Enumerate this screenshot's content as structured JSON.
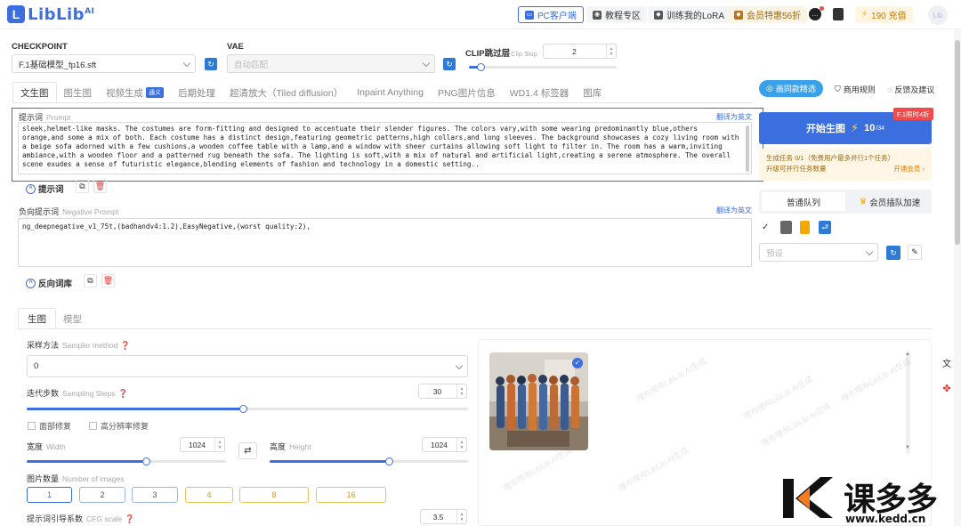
{
  "header": {
    "logo_text": "LibLib",
    "logo_sup": "AI",
    "pc_client": "PC客户端",
    "tutorial": "教程专区",
    "train_lora": "训练我的LoRA",
    "member": "会员特惠56折",
    "credits": "190 充值",
    "avatar": "Lib"
  },
  "checkpoint": {
    "label": "CHECKPOINT",
    "value": "F.1基础模型_fp16.sft"
  },
  "vae": {
    "label": "VAE",
    "value": "自动匹配"
  },
  "clip": {
    "label": "CLIP跳过层",
    "sublabel": "Clip Skip",
    "value": "2",
    "level": 0.08
  },
  "tabs": [
    {
      "label": "文生图"
    },
    {
      "label": "图生图"
    },
    {
      "label": "视频生成",
      "badge": "通义"
    },
    {
      "label": "后期处理"
    },
    {
      "label": "超清放大（Tiled diffusion）"
    },
    {
      "label": "Inpaint Anything"
    },
    {
      "label": "PNG图片信息"
    },
    {
      "label": "WD1.4 标签器"
    },
    {
      "label": "图库"
    }
  ],
  "right_links": {
    "pick": "画同款精选",
    "rules": "商用规则",
    "feedback": "反馈及建议"
  },
  "prompt": {
    "label": "提示词",
    "sublabel": "Prompt",
    "translate": "翻译为英文",
    "text": "sleek,helmet-like masks. The costumes are form-fitting and designed to accentuate their slender figures. The colors vary,with some wearing predominantly blue,others orange,and some a mix of both. Each costume has a distinct design,featuring geometric patterns,high collars,and long sleeves. The background showcases a cozy living room with a beige sofa adorned with a few cushions,a wooden coffee table with a lamp,and a window with sheer curtains allowing soft light to filter in. The room has a warm,inviting ambiance,with a wooden floor and a patterned rug beneath the sofa. The lighting is soft,with a mix of natural and artificial light,creating a serene atmosphere. The overall scene exudes a sense of futuristic elegance,blending elements of fashion and technology in a domestic setting..",
    "chip": "提示词"
  },
  "negative": {
    "label": "负向提示词",
    "sublabel": "Negative Prompt",
    "translate": "翻译为英文",
    "text": "ng_deepnegative_v1_75t,(badhandv4:1.2),EasyNegative,(worst quality:2),",
    "chip": "反向词库"
  },
  "generate": {
    "label": "开始生图",
    "cost": "10",
    "cost_suffix": "/34",
    "promo": "F.1限时4折"
  },
  "task": {
    "line1": "生成任务 0/1（免费用户最多并行1个任务）",
    "line2": "升级可并行任务数量",
    "upgrade": "开通会员 ›"
  },
  "queue": {
    "normal": "普通队列",
    "vip": "会员插队加速"
  },
  "preset": {
    "placeholder": "预设"
  },
  "subtabs": [
    {
      "label": "生图"
    },
    {
      "label": "模型"
    }
  ],
  "sampler": {
    "label": "采样方法",
    "sublabel": "Sampler method",
    "value": "0"
  },
  "steps": {
    "label": "迭代步数",
    "sublabel": "Sampling Steps",
    "value": "30",
    "level": 0.49
  },
  "options": {
    "face_fix": "面部修复",
    "hires_fix": "高分辨率修复"
  },
  "width": {
    "label": "宽度",
    "sublabel": "Width",
    "value": "1024",
    "level": 0.6
  },
  "height": {
    "label": "高度",
    "sublabel": "Height",
    "value": "1024",
    "level": 0.6
  },
  "image_count": {
    "label": "图片数量",
    "sublabel": "Number of images",
    "options": [
      "1",
      "2",
      "3",
      "4",
      "8",
      "16"
    ]
  },
  "cfg": {
    "label": "提示词引导系数",
    "sublabel": "CFG scale",
    "value": "3.5"
  },
  "watermark": "哩布哩布LibLib AI生成",
  "brand": {
    "name": "课多多",
    "url": "www.kedd.cn"
  },
  "colors": {
    "accent": "#3b6fe0",
    "highlight_border": "#e53935",
    "gold": "#f0c15a"
  }
}
